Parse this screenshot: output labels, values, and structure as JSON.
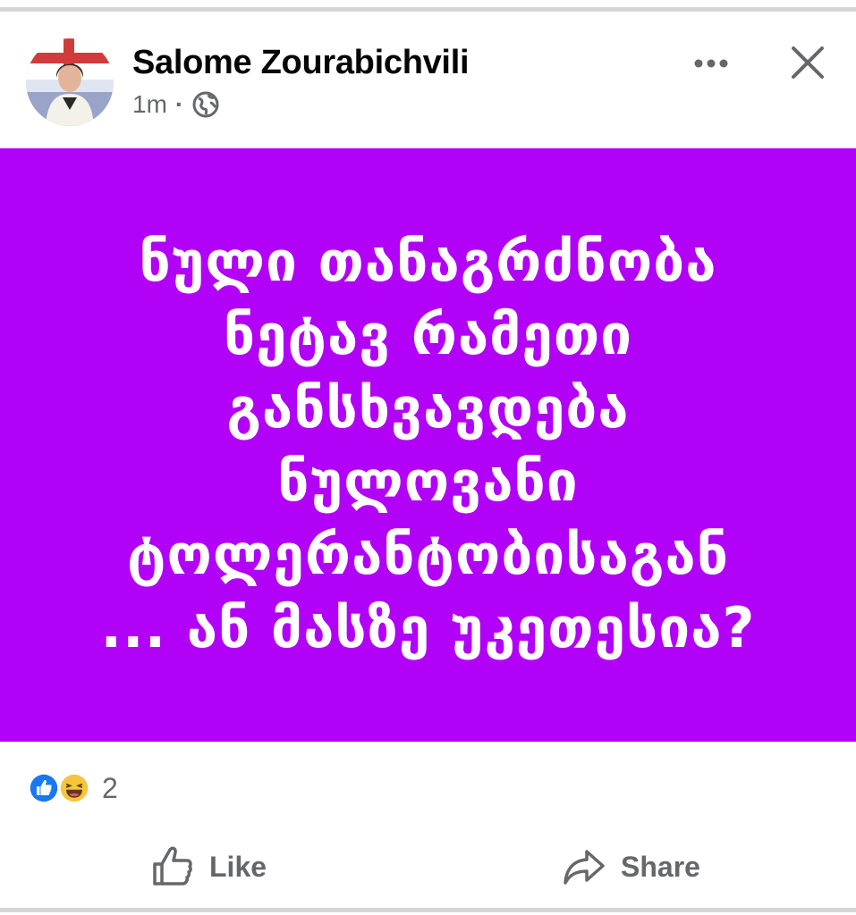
{
  "post": {
    "author": "Salome Zourabichvili",
    "time": "1m",
    "separator": "·",
    "privacy_icon": "globe-icon",
    "background_color": "#b201f7",
    "text_lines": [
      "ნული თანაგრძნობა",
      "ნეტავ რამეთი",
      "განსხვავდება",
      "ნულოვანი",
      "ტოლერანტობისაგან",
      "... ან მასზე უკეთესია?"
    ]
  },
  "header_actions": {
    "more_icon": "more-horizontal-icon",
    "close_icon": "close-icon"
  },
  "reactions": {
    "icons": [
      "like-reaction-icon",
      "haha-reaction-icon"
    ],
    "count": "2"
  },
  "actions": {
    "like_label": "Like",
    "share_label": "Share"
  }
}
